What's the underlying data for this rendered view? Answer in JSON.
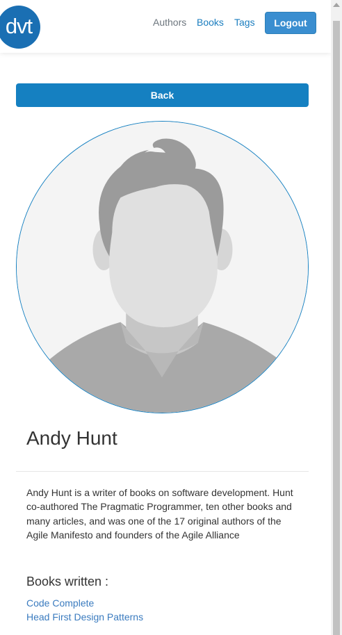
{
  "header": {
    "logo_text": "dvt",
    "nav": {
      "authors": "Authors",
      "books": "Books",
      "tags": "Tags"
    },
    "logout_label": "Logout"
  },
  "back_label": "Back",
  "author": {
    "name": "Andy Hunt",
    "bio": "Andy Hunt is a writer of books on software development. Hunt co-authored The Pragmatic Programmer, ten other books and many articles, and was one of the 17 original authors of the Agile Manifesto and founders of the Agile Alliance"
  },
  "books_heading": "Books written :",
  "books": [
    "Code Complete",
    "Head First Design Patterns"
  ],
  "colors": {
    "primary": "#1580c1",
    "logo": "#1a6fb3",
    "link": "#3a7bbf"
  },
  "icons": {
    "avatar": "default-profile-avatar-icon"
  }
}
